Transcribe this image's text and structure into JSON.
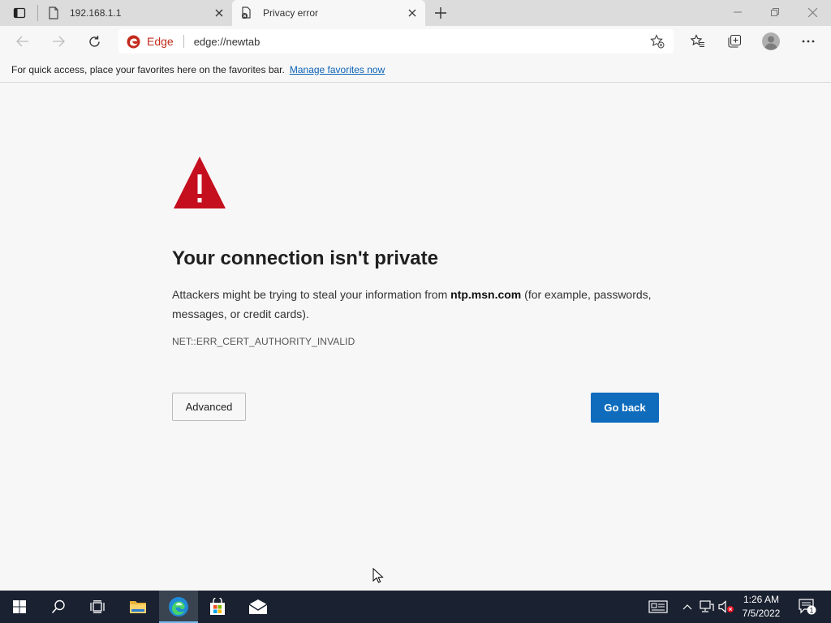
{
  "tabs": [
    {
      "title": "192.168.1.1",
      "icon": "page-icon"
    },
    {
      "title": "Privacy error",
      "icon": "error-page-icon"
    }
  ],
  "toolbar": {
    "brand": "Edge",
    "url": "edge://newtab"
  },
  "favorites_bar": {
    "message": "For quick access, place your favorites here on the favorites bar.",
    "link": "Manage favorites now"
  },
  "error_page": {
    "heading": "Your connection isn't private",
    "desc_before": "Attackers might be trying to steal your information from ",
    "host": "ntp.msn.com",
    "desc_after": " (for example, passwords, messages, or credit cards).",
    "error_code": "NET::ERR_CERT_AUTHORITY_INVALID",
    "advanced_label": "Advanced",
    "go_back_label": "Go back"
  },
  "taskbar": {
    "time": "1:26 AM",
    "date": "7/5/2022",
    "notification_count": "1"
  },
  "colors": {
    "warning_red": "#c50f1f",
    "primary_button": "#0f6cbd",
    "link": "#0b62b8",
    "taskbar": "#1a2130"
  }
}
